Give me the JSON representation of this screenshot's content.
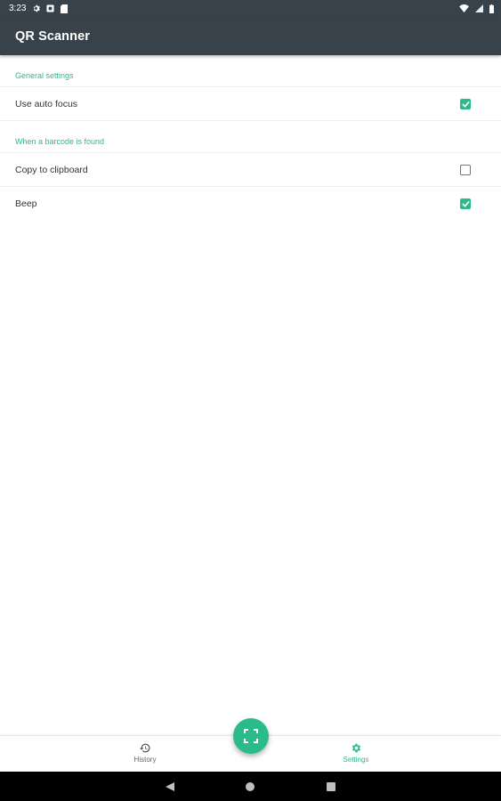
{
  "status_bar": {
    "time": "3:23",
    "icons_left": [
      "gear-icon",
      "notification-icon",
      "sd-card-icon"
    ],
    "icons_right": [
      "wifi-icon",
      "signal-icon",
      "battery-icon"
    ]
  },
  "app_bar": {
    "title": "QR Scanner"
  },
  "settings": {
    "general_header": "General settings",
    "auto_focus": {
      "label": "Use auto focus",
      "checked": true
    },
    "barcode_header": "When a barcode is found",
    "copy_clipboard": {
      "label": "Copy to clipboard",
      "checked": false
    },
    "beep": {
      "label": "Beep",
      "checked": true
    }
  },
  "bottom_nav": {
    "history_label": "History",
    "settings_label": "Settings",
    "active": "Settings"
  },
  "fab": {
    "icon": "scan-frame-icon"
  },
  "colors": {
    "accent": "#2bbb8a",
    "app_bar": "#37424a",
    "system_nav": "#000000"
  }
}
